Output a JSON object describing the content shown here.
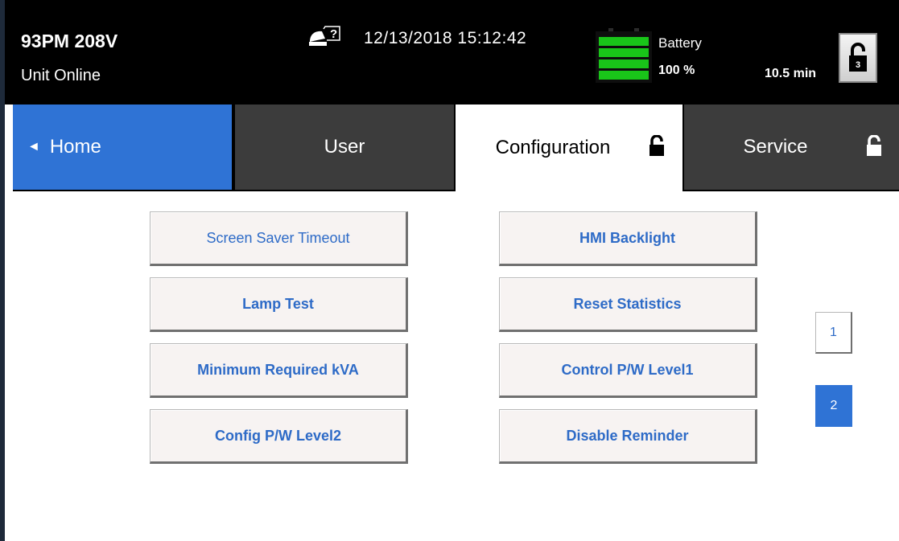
{
  "header": {
    "model": "93PM 208V",
    "unit_status": "Unit Online",
    "datetime": "12/13/2018 15:12:42",
    "battery_label": "Battery",
    "battery_percent": "100 %",
    "battery_runtime": "10.5 min",
    "lock_level": "3",
    "status_icon_glyph": "?",
    "icons": [
      "ups-status-question-icon",
      "battery-icon",
      "unlock-icon"
    ]
  },
  "tabs": {
    "home": {
      "label": "Home",
      "arrow": "◄"
    },
    "user": {
      "label": "User"
    },
    "configuration": {
      "label": "Configuration",
      "icon": "unlock-icon"
    },
    "service": {
      "label": "Service",
      "icon": "unlock-icon"
    }
  },
  "buttons": {
    "screen_saver_timeout": "Screen Saver Timeout",
    "hmi_backlight": "HMI Backlight",
    "lamp_test": "Lamp Test",
    "reset_statistics": "Reset Statistics",
    "minimum_required_kva": "Minimum Required kVA",
    "control_pw_level1": "Control P/W Level1",
    "config_pw_level2": "Config P/W Level2",
    "disable_reminder": "Disable Reminder"
  },
  "pagination": {
    "page1": "1",
    "page2": "2",
    "current": "2"
  },
  "colors": {
    "accent_blue": "#2f73d5",
    "tab_dark": "#3c3c3c",
    "header_bg": "#000000",
    "battery_green": "#19c519",
    "button_text": "#2e6bc7",
    "button_bg": "#f7f3f2"
  }
}
